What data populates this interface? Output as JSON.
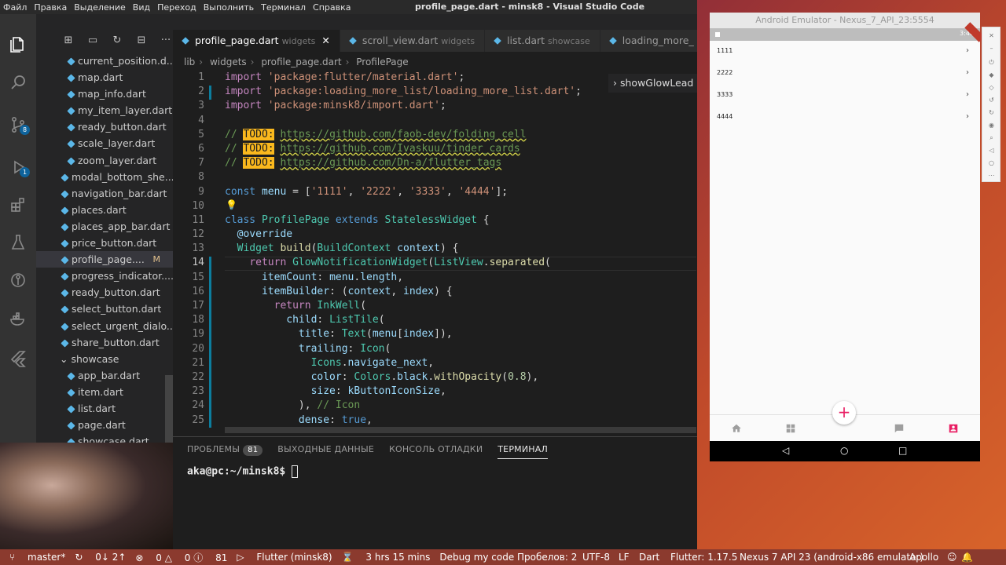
{
  "window": {
    "title": "profile_page.dart - minsk8 - Visual Studio Code",
    "menu": [
      "Файл",
      "Правка",
      "Выделение",
      "Вид",
      "Переход",
      "Выполнить",
      "Терминал",
      "Справка"
    ]
  },
  "activity_bar": {
    "scm_badge": "8",
    "debug_badge": "1"
  },
  "explorer": {
    "items": [
      {
        "label": "current_position.d...",
        "indent": 2,
        "type": "file"
      },
      {
        "label": "map.dart",
        "indent": 2,
        "type": "file"
      },
      {
        "label": "map_info.dart",
        "indent": 2,
        "type": "file"
      },
      {
        "label": "my_item_layer.dart",
        "indent": 2,
        "type": "file"
      },
      {
        "label": "ready_button.dart",
        "indent": 2,
        "type": "file"
      },
      {
        "label": "scale_layer.dart",
        "indent": 2,
        "type": "file"
      },
      {
        "label": "zoom_layer.dart",
        "indent": 2,
        "type": "file"
      },
      {
        "label": "modal_bottom_she...",
        "indent": 1,
        "type": "file"
      },
      {
        "label": "navigation_bar.dart",
        "indent": 1,
        "type": "file"
      },
      {
        "label": "places.dart",
        "indent": 1,
        "type": "file"
      },
      {
        "label": "places_app_bar.dart",
        "indent": 1,
        "type": "file"
      },
      {
        "label": "price_button.dart",
        "indent": 1,
        "type": "file"
      },
      {
        "label": "profile_page....",
        "indent": 1,
        "type": "file",
        "selected": true,
        "flag": "M"
      },
      {
        "label": "progress_indicator....",
        "indent": 1,
        "type": "file"
      },
      {
        "label": "ready_button.dart",
        "indent": 1,
        "type": "file"
      },
      {
        "label": "select_button.dart",
        "indent": 1,
        "type": "file"
      },
      {
        "label": "select_urgent_dialo...",
        "indent": 1,
        "type": "file"
      },
      {
        "label": "share_button.dart",
        "indent": 1,
        "type": "file"
      },
      {
        "label": "showcase",
        "indent": 1,
        "type": "folder"
      },
      {
        "label": "app_bar.dart",
        "indent": 2,
        "type": "file"
      },
      {
        "label": "item.dart",
        "indent": 2,
        "type": "file"
      },
      {
        "label": "list.dart",
        "indent": 2,
        "type": "file"
      },
      {
        "label": "page.dart",
        "indent": 2,
        "type": "file"
      },
      {
        "label": "showcase.dart",
        "indent": 2,
        "type": "file"
      }
    ]
  },
  "tabs": [
    {
      "name": "profile_page.dart",
      "desc": "widgets",
      "active": true
    },
    {
      "name": "scroll_view.dart",
      "desc": "widgets",
      "active": false
    },
    {
      "name": "list.dart",
      "desc": "showcase",
      "active": false
    },
    {
      "name": "loading_more_",
      "desc": "",
      "active": false
    }
  ],
  "breadcrumb": [
    "lib",
    "widgets",
    "profile_page.dart",
    "ProfilePage"
  ],
  "sticky_outline": "showGlowLead",
  "editor": {
    "line_numbers": [
      "1",
      "2",
      "3",
      "4",
      "5",
      "6",
      "7",
      "8",
      "9",
      "10",
      "11",
      "12",
      "13",
      "14",
      "15",
      "16",
      "17",
      "18",
      "19",
      "20",
      "21",
      "22",
      "23",
      "24",
      "25"
    ],
    "current_line": "14"
  },
  "panel": {
    "tabs": [
      {
        "label": "ПРОБЛЕМЫ",
        "badge": "81",
        "active": false
      },
      {
        "label": "ВЫХОДНЫЕ ДАННЫЕ",
        "active": false
      },
      {
        "label": "КОНСОЛЬ ОТЛАДКИ",
        "active": false
      },
      {
        "label": "ТЕРМИНАЛ",
        "active": true
      }
    ],
    "prompt_user": "aka@pc",
    "prompt_path": ":~/minsk8$ "
  },
  "status_bar": {
    "branch": "master*",
    "sync": "0↓ 2↑",
    "errors": "0",
    "warnings": "0",
    "info": "81",
    "flutter_run": "Flutter (minsk8)",
    "timer": "3 hrs 15 mins",
    "debug_mode": "Debug my code",
    "indent": "Пробелов: 2",
    "encoding": "UTF-8",
    "eol": "LF",
    "language": "Dart",
    "flutter_version": "Flutter: 1.17.5",
    "device": "Nexus 7 API 23 (android-x86 emulator)",
    "theme": "Apollo"
  },
  "emulator": {
    "title": "Android Emulator - Nexus_7_API_23:5554",
    "clock": "3:46",
    "list_items": [
      "1111",
      "2222",
      "3333",
      "4444"
    ],
    "bottom_nav": [
      "home-icon",
      "apps-icon",
      "chat-icon",
      "profile-icon"
    ],
    "fab": "+",
    "accent": "#e91e63"
  }
}
